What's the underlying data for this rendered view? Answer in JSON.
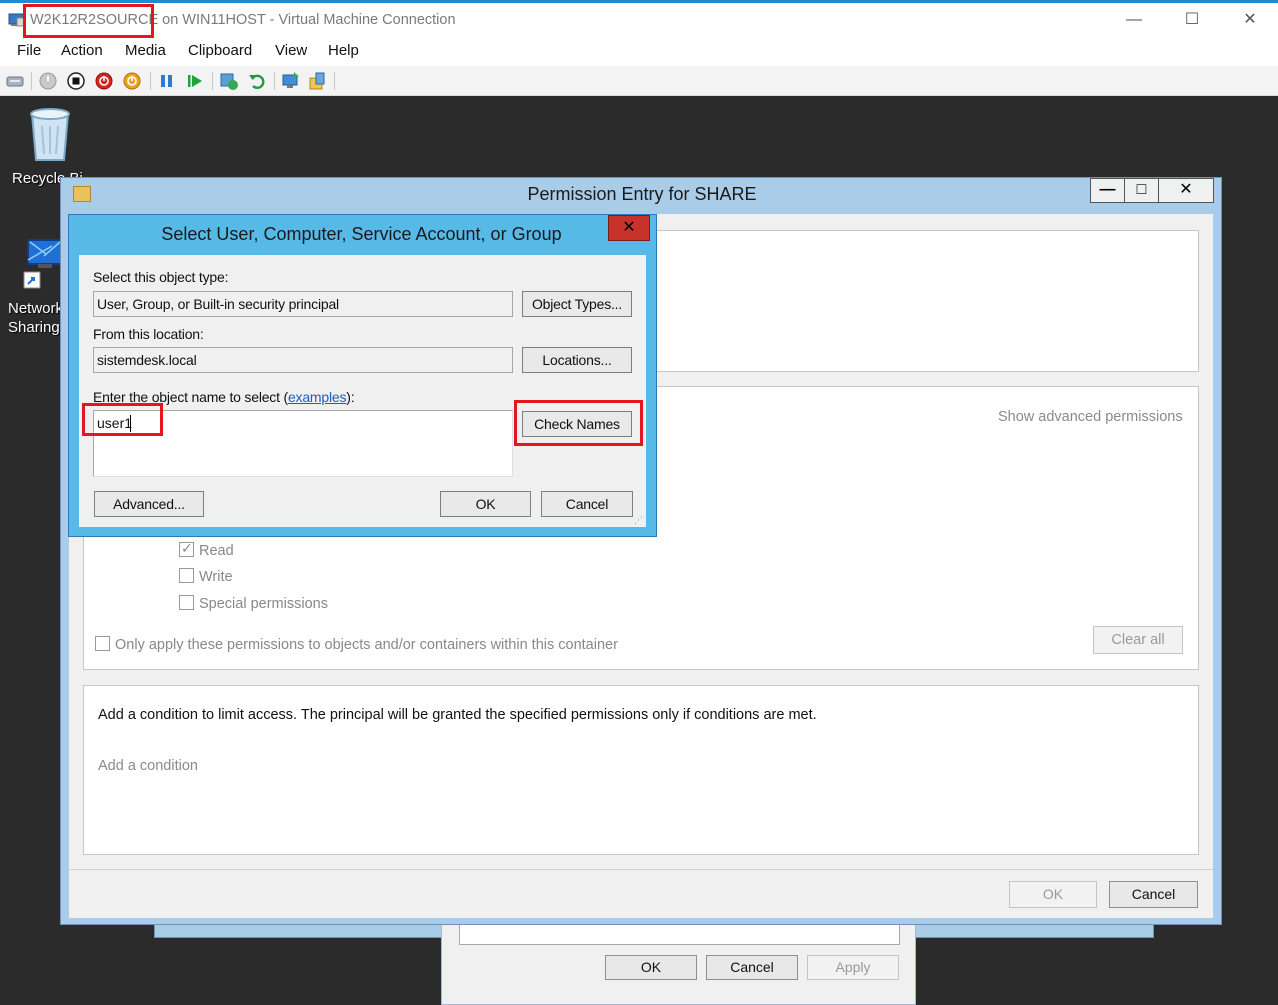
{
  "host": {
    "title_vm": "W2K12R2SOURCE",
    "title_rest": " on WIN11HOST - Virtual Machine Connection",
    "minimize": "—",
    "maximize": "☐",
    "close": "✕",
    "menu": [
      "File",
      "Action",
      "Media",
      "Clipboard",
      "View",
      "Help"
    ]
  },
  "toolbar": {
    "icons": [
      "ctrl-alt-del-icon",
      "start-icon",
      "turn-off-icon",
      "shut-down-icon",
      "save-icon",
      "pause-icon",
      "resume-icon",
      "checkpoint-icon",
      "revert-icon",
      "enhanced-session-icon",
      "share-icon"
    ]
  },
  "desktop": {
    "recycle_bin": "Recycle Bi",
    "network_line1": "Network",
    "network_line2": "Sharing"
  },
  "permission_window": {
    "title": "Permission Entry for SHARE",
    "minimize": "—",
    "maximize": "□",
    "close": "✕",
    "show_advanced": "Show advanced permissions",
    "permissions": [
      {
        "label": "Read",
        "checked": true
      },
      {
        "label": "Write",
        "checked": false
      },
      {
        "label": "Special permissions",
        "checked": false
      }
    ],
    "only_apply": "Only apply these permissions to objects and/or containers within this container",
    "clear_all": "Clear all",
    "condition_text": "Add a condition to limit access. The principal will be granted the specified permissions only if conditions are met.",
    "add_condition": "Add a condition",
    "ok": "OK",
    "cancel": "Cancel"
  },
  "background_window": {
    "ok": "OK",
    "cancel": "Cancel",
    "apply": "Apply"
  },
  "select_dialog": {
    "title": "Select User, Computer, Service Account, or Group",
    "close": "✕",
    "object_type_label": "Select this object type:",
    "object_type_value": "User, Group, or Built-in security principal",
    "object_types_button": "Object Types...",
    "location_label": "From this location:",
    "location_value": "sistemdesk.local",
    "locations_button": "Locations...",
    "object_name_label": "Enter the object name to select (",
    "examples_link": "examples",
    "object_name_label_end": "):",
    "object_name_value": "user1",
    "check_names_button": "Check Names",
    "advanced_button": "Advanced...",
    "ok_button": "OK",
    "cancel_button": "Cancel"
  },
  "colors": {
    "highlight": "#e3171f",
    "dialog_frame": "#56b9e6",
    "window_frame": "#a9cce8",
    "link": "#1a5fc4"
  }
}
